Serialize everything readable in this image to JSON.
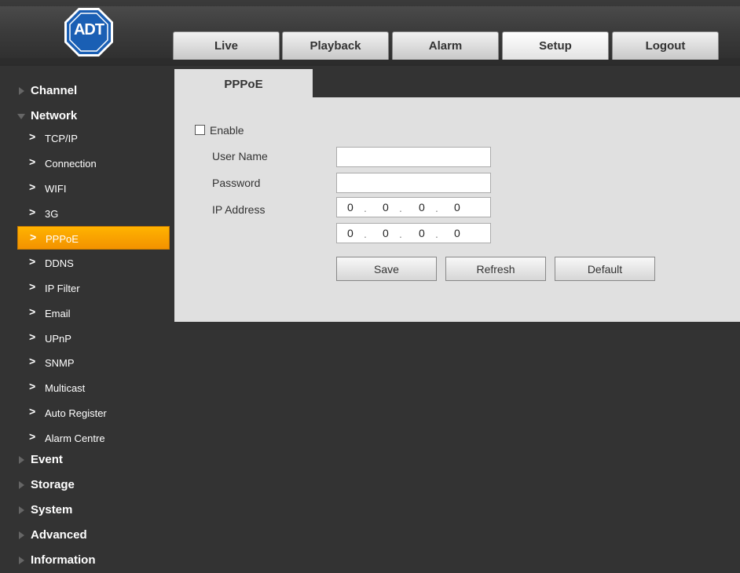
{
  "header": {
    "logo_text": "ADT",
    "tabs": [
      {
        "label": "Live"
      },
      {
        "label": "Playback"
      },
      {
        "label": "Alarm"
      },
      {
        "label": "Setup",
        "active": true
      },
      {
        "label": "Logout"
      }
    ]
  },
  "sidebar": {
    "groups": {
      "channel": "Channel",
      "network": "Network",
      "event": "Event",
      "storage": "Storage",
      "system": "System",
      "advanced": "Advanced",
      "information": "Information"
    },
    "network_items": [
      {
        "label": "TCP/IP"
      },
      {
        "label": "Connection"
      },
      {
        "label": "WIFI"
      },
      {
        "label": "3G"
      },
      {
        "label": "PPPoE",
        "active": true
      },
      {
        "label": "DDNS"
      },
      {
        "label": "IP Filter"
      },
      {
        "label": "Email"
      },
      {
        "label": "UPnP"
      },
      {
        "label": "SNMP"
      },
      {
        "label": "Multicast"
      },
      {
        "label": "Auto Register"
      },
      {
        "label": "Alarm Centre"
      }
    ]
  },
  "panel": {
    "tab_label": "PPPoE",
    "enable_label": "Enable",
    "enable_checked": false,
    "user_name_label": "User Name",
    "user_name_value": "",
    "password_label": "Password",
    "password_value": "",
    "ip_address_label": "IP Address",
    "ip_address_1": [
      "0",
      "0",
      "0",
      "0"
    ],
    "ip_address_2": [
      "0",
      "0",
      "0",
      "0"
    ],
    "buttons": {
      "save": "Save",
      "refresh": "Refresh",
      "default": "Default"
    }
  },
  "colors": {
    "background": "#333333",
    "panel": "#e0e0e0",
    "accent": "#f39200",
    "logo_blue": "#1a5fb4"
  },
  "icons": {
    "logo": "adt-octagon-logo",
    "group_expander": "triangle-icon",
    "item_bullet": "chevron-right-icon"
  }
}
